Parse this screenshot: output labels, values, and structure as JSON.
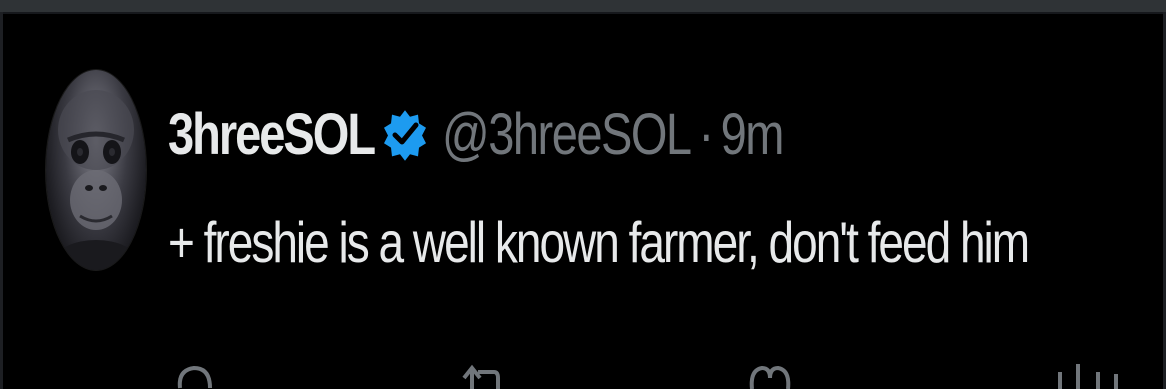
{
  "tweet": {
    "author": {
      "display_name": "3hreeSOL",
      "handle": "@3hreeSOL",
      "verified": true,
      "avatar_icon": "monkey-avatar"
    },
    "separator": "·",
    "timestamp": "9m",
    "text": "+ freshie is a well known farmer, don't feed him"
  },
  "actions": [
    {
      "name": "reply",
      "icon": "reply-icon"
    },
    {
      "name": "repost",
      "icon": "repost-icon"
    },
    {
      "name": "like",
      "icon": "heart-icon"
    },
    {
      "name": "views",
      "icon": "views-icon"
    }
  ],
  "colors": {
    "background": "#000000",
    "text_primary": "#e7e9ea",
    "text_secondary": "#71767b",
    "verified_blue": "#1d9bf0",
    "divider": "#2f3336"
  }
}
